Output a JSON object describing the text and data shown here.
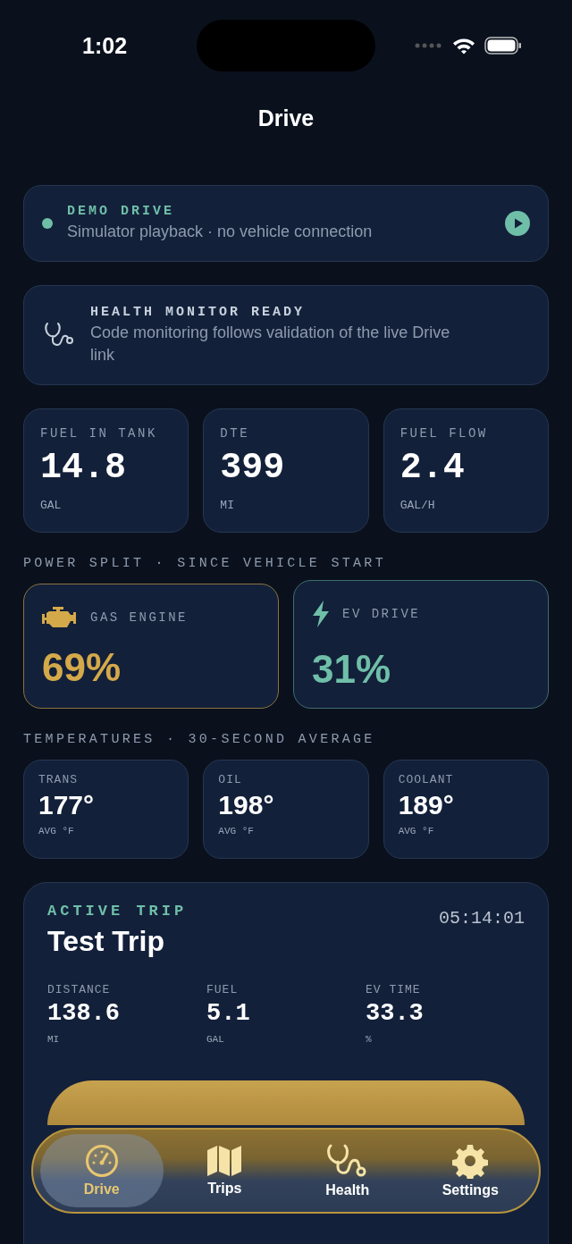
{
  "status_bar": {
    "time": "1:02"
  },
  "title": "Drive",
  "demo": {
    "label": "DEMO DRIVE",
    "text": "Simulator playback · no vehicle connection"
  },
  "health": {
    "label": "HEALTH MONITOR READY",
    "text": "Code monitoring follows validation of the live Drive link"
  },
  "metrics": [
    {
      "label": "FUEL IN TANK",
      "value": "14.8",
      "unit": "GAL"
    },
    {
      "label": "DTE",
      "value": "399",
      "unit": "MI"
    },
    {
      "label": "FUEL FLOW",
      "value": "2.4",
      "unit": "GAL/H"
    }
  ],
  "power_split": {
    "label": "POWER SPLIT · SINCE VEHICLE START",
    "items": [
      {
        "kind": "gas",
        "label": "GAS ENGINE",
        "value": "69%"
      },
      {
        "kind": "ev",
        "label": "EV DRIVE",
        "value": "31%"
      }
    ]
  },
  "temperatures": {
    "label": "TEMPERATURES · 30-SECOND AVERAGE",
    "items": [
      {
        "label": "TRANS",
        "value": "177°",
        "unit": "AVG °F"
      },
      {
        "label": "OIL",
        "value": "198°",
        "unit": "AVG °F"
      },
      {
        "label": "COOLANT",
        "value": "189°",
        "unit": "AVG °F"
      }
    ]
  },
  "trip": {
    "label": "ACTIVE TRIP",
    "name": "Test Trip",
    "timer": "05:14:01",
    "stats": [
      {
        "label": "DISTANCE",
        "value": "138.6",
        "unit": "MI"
      },
      {
        "label": "FUEL",
        "value": "5.1",
        "unit": "GAL"
      },
      {
        "label": "EV TIME",
        "value": "33.3",
        "unit": "%"
      }
    ]
  },
  "tab_bar": [
    {
      "kind": "drive",
      "label": "Drive",
      "selected": true
    },
    {
      "kind": "trips",
      "label": "Trips",
      "selected": false
    },
    {
      "kind": "health",
      "label": "Health",
      "selected": false
    },
    {
      "kind": "settings",
      "label": "Settings",
      "selected": false
    }
  ]
}
